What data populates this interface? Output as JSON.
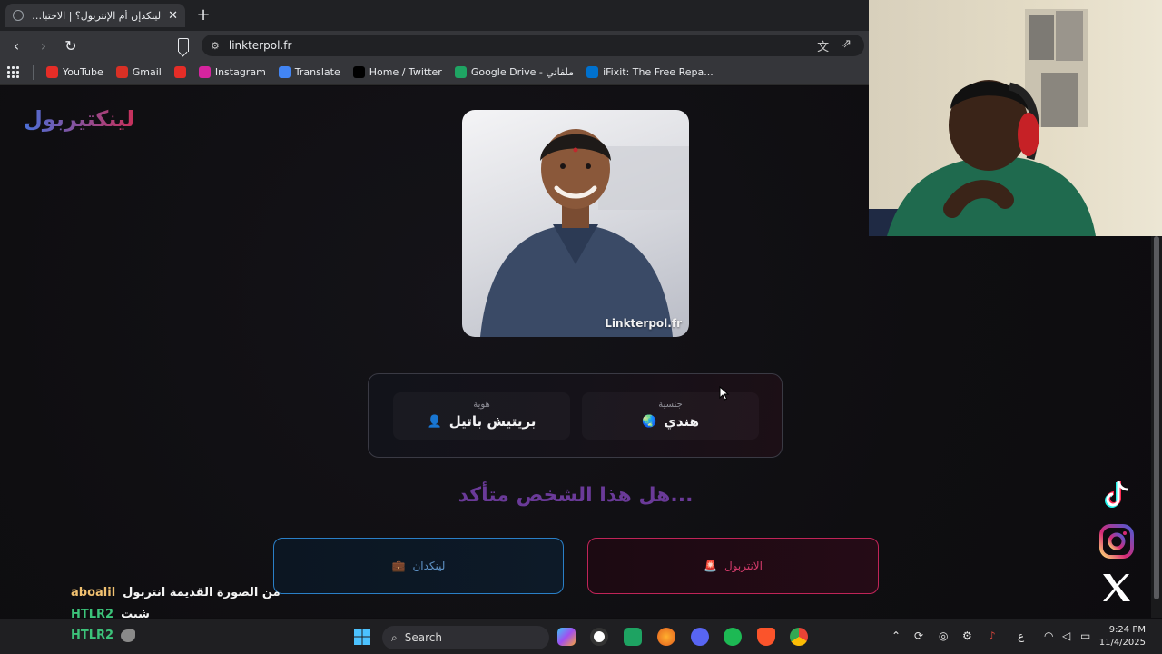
{
  "browser": {
    "tab_title": "لينكدإن أم الإنتربول؟ | الاختبار الأكثر",
    "url": "linkterpol.fr",
    "bookmarks": [
      {
        "label": "YouTube",
        "color": "#e52d27",
        "icon": "youtube-icon"
      },
      {
        "label": "Gmail",
        "color": "#d93025",
        "icon": "gmail-icon"
      },
      {
        "label": "",
        "color": "#e52d27",
        "icon": "youtube-icon"
      },
      {
        "label": "Instagram",
        "color": "#d6249f",
        "icon": "instagram-icon"
      },
      {
        "label": "Translate",
        "color": "#4285f4",
        "icon": "translate-icon"
      },
      {
        "label": "Home / Twitter",
        "color": "#000000",
        "icon": "x-icon"
      },
      {
        "label": "Google Drive - ملفاتي",
        "color": "#1fa463",
        "icon": "drive-icon"
      },
      {
        "label": "iFixit: The Free Repa...",
        "color": "#0071ce",
        "icon": "ifixit-icon"
      }
    ]
  },
  "site": {
    "logo": "لينكتيربول",
    "photo_watermark": "Linkterpol.fr",
    "identity_label": "هوية",
    "identity_value": "بريتيش باتيل",
    "identity_emoji": "👤",
    "nationality_label": "جنسية",
    "nationality_value": "هندي",
    "nationality_emoji": "🌏",
    "question": "...هل هذا الشخص متأكد",
    "linkedin_button": "لينكدان",
    "linkedin_emoji": "💼",
    "interpol_button": "الانتربول",
    "interpol_emoji": "🚨"
  },
  "chat": [
    {
      "user": "aboalil",
      "message": "من الصورة القديمة انتربول",
      "user_color": "#f0c070"
    },
    {
      "user": "HTLR2",
      "message": "شيت",
      "user_color": "#3cc37a"
    },
    {
      "user": "HTLR2",
      "message": "",
      "user_color": "#3cc37a"
    }
  ],
  "taskbar": {
    "search_label": "Search",
    "language": "ع",
    "time": "9:24 PM",
    "date": "11/4/2025"
  }
}
